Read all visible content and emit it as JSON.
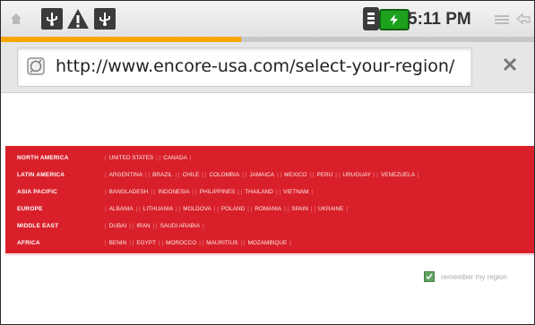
{
  "status_bar": {
    "time": "5:11 PM",
    "icons": [
      "home-icon",
      "usb-icon",
      "warning-icon",
      "usb-icon",
      "phone-signal-icon",
      "battery-charging-icon",
      "menu-icon",
      "back-icon"
    ]
  },
  "page_load_progress": 0.45,
  "url_bar": {
    "url": "http://www.encore-usa.com/select-your-region/"
  },
  "regions": [
    {
      "name": "NORTH AMERICA",
      "countries": [
        "UNITED STATES",
        "CANADA"
      ]
    },
    {
      "name": "LATIN AMERICA",
      "countries": [
        "ARGENTINA",
        "BRAZIL",
        "CHILE",
        "COLOMBIA",
        "JAMAICA",
        "MEXICO",
        "PERU",
        "URUGUAY",
        "VENEZUELA"
      ]
    },
    {
      "name": "ASIA PACIFIC",
      "countries": [
        "BANGLADESH",
        "INDONESIA",
        "PHILIPPINES",
        "THAILAND",
        "VIETNAM"
      ]
    },
    {
      "name": "EUROPE",
      "countries": [
        "ALBANIA",
        "LITHUANIA",
        "MOLDOVA",
        "POLAND",
        "ROMANIA",
        "SPAIN",
        "UKRAINE"
      ]
    },
    {
      "name": "MIDDLE EAST",
      "countries": [
        "DUBAI",
        "IRAN",
        "SAUDI ARABIA"
      ]
    },
    {
      "name": "AFRICA",
      "countries": [
        "BENIN",
        "EGYPT",
        "MOROCCO",
        "MAURITIUS",
        "MOZAMBIQUE"
      ]
    }
  ],
  "remember": {
    "label": "remember my region",
    "checked": true
  },
  "colors": {
    "panel_red": "#d9202a",
    "progress_orange": "#f7a600",
    "battery_green": "#1da11d"
  }
}
